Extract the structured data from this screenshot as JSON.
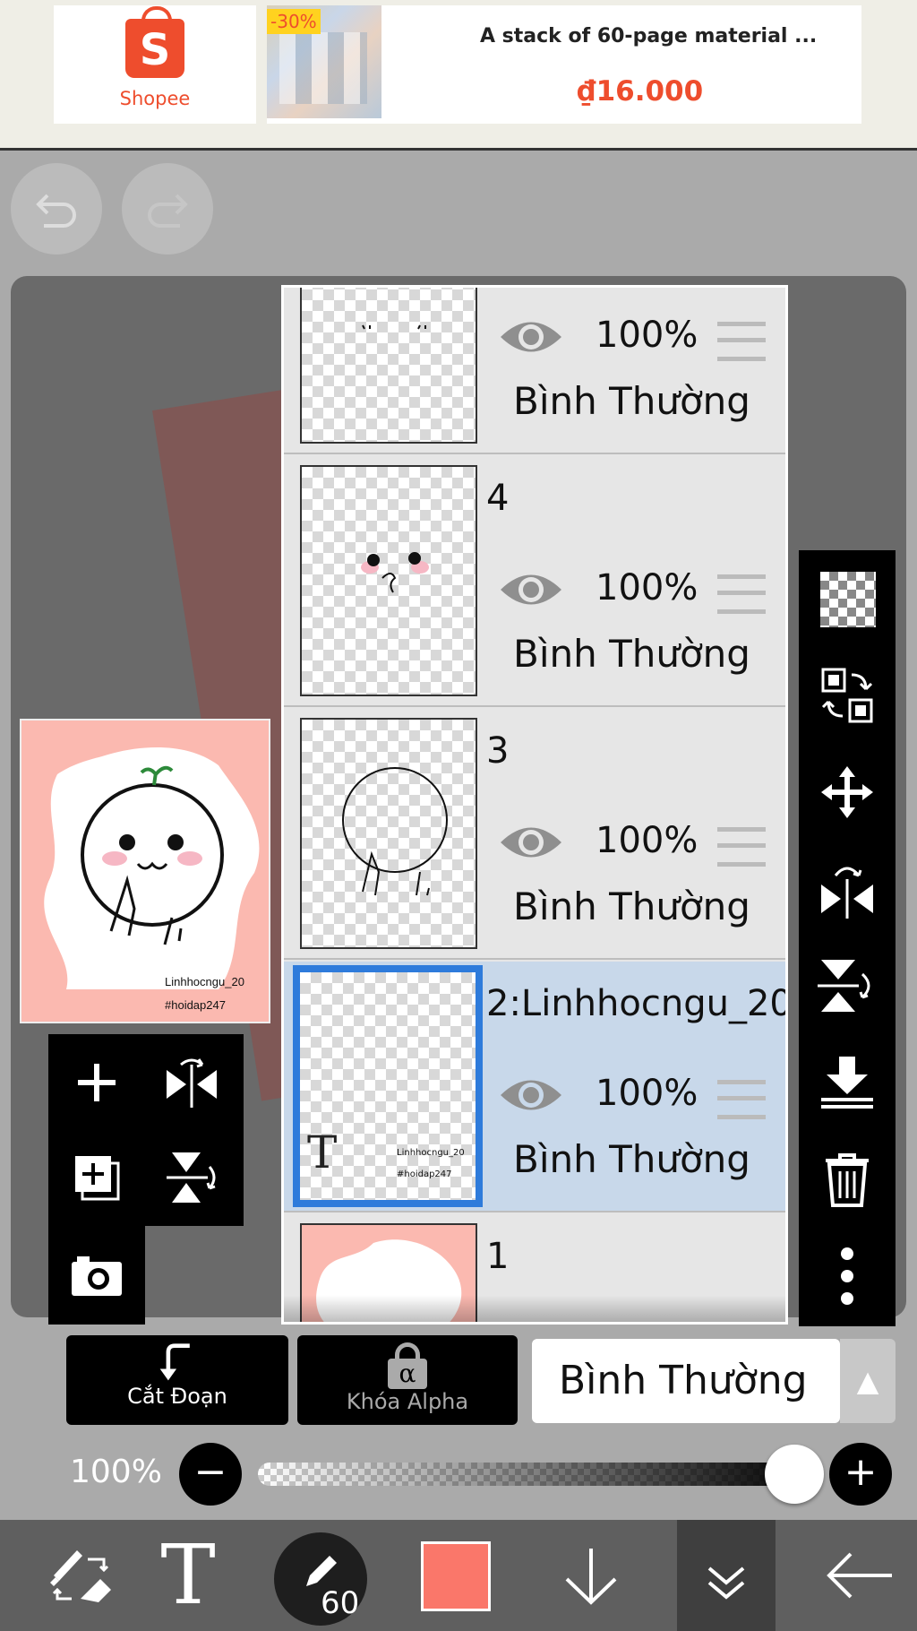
{
  "ad": {
    "brand": "Shopee",
    "brand_initial": "S",
    "discount": "-30%",
    "title": "A stack of 60-page material ...",
    "price": "₫16.000",
    "brand_color": "#ee4d2d"
  },
  "toolbar_top": {
    "undo_icon": "undo-icon",
    "redo_icon": "redo-icon"
  },
  "preview": {
    "watermark_1": "Linhhocngu_20",
    "watermark_2": "#hoidap247"
  },
  "layers": [
    {
      "name": "",
      "opacity": "100%",
      "blend": "Bình Thường",
      "selected": false
    },
    {
      "name": "4",
      "opacity": "100%",
      "blend": "Bình Thường",
      "selected": false
    },
    {
      "name": "3",
      "opacity": "100%",
      "blend": "Bình Thường",
      "selected": false
    },
    {
      "name": "2:Linhhocngu_20",
      "opacity": "100%",
      "blend": "Bình Thường",
      "selected": true,
      "thumb_text_1": "Linhhocngu_20",
      "thumb_text_2": "#hoidap247",
      "thumb_t": "T"
    },
    {
      "name": "1",
      "opacity": "",
      "blend": "",
      "selected": false
    }
  ],
  "controls": {
    "clip_label": "Cắt Đoạn",
    "alpha_label": "Khóa Alpha",
    "alpha_glyph": "α",
    "blend_mode": "Bình Thường",
    "opacity_label": "100%",
    "opacity_value": 1.0
  },
  "bottom_nav": {
    "text_tool": "T",
    "brush_size": "60",
    "current_color": "#fa776a"
  },
  "colors": {
    "selected_layer_bg": "#c8d8ea",
    "selected_layer_border": "#2e7bdb",
    "canvas_pink": "#fbb9b0"
  }
}
